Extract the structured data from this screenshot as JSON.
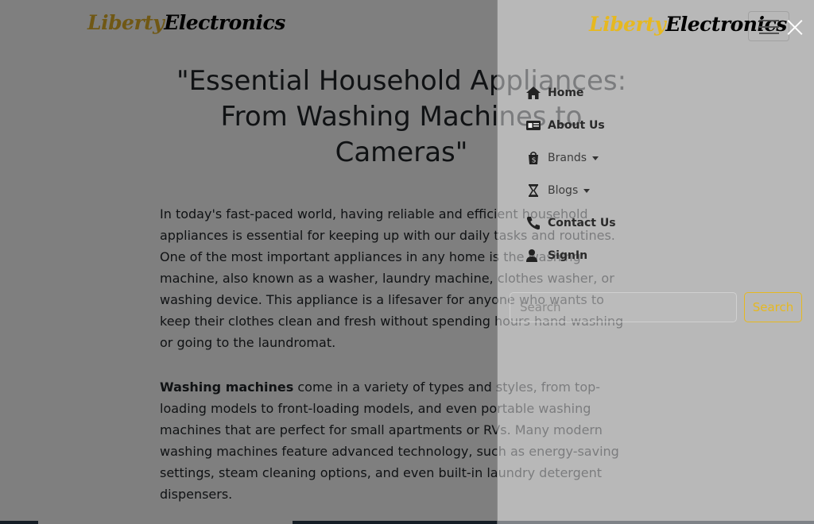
{
  "page": {
    "brand": {
      "part1": "Liberty",
      "part2": "Electronics"
    },
    "hero_title": "\"Essential Household Appliances: From Washing Machines to Cameras\"",
    "paragraph1": "In today's fast-paced world, having reliable and efficient household appliances is essential for keeping up with our daily tasks and routines. One of the most important appliances in any home is the washing machine, also known as a washer, laundry machine, clothes washer, or washing device. This appliance is a lifesaver for anyone who wants to keep their clothes clean and fresh without spending hours hand-washing or going to the laundromat.",
    "paragraph2_bold": "Washing machines",
    "paragraph2_rest": " come in a variety of types and styles, from top-loading models to front-loading models, and even portable washing machines that are perfect for small apartments or RVs. Many modern washing machines feature advanced technology, such as energy-saving settings, steam cleaning options, and even built-in laundry detergent dispensers."
  },
  "offcanvas": {
    "brand": {
      "part1": "Liberty",
      "part2": "Electronics"
    },
    "nav": [
      {
        "label": "Home",
        "icon": "home-icon",
        "dropdown": false
      },
      {
        "label": "About Us",
        "icon": "id-card-icon",
        "dropdown": false
      },
      {
        "label": "Brands",
        "icon": "shopping-bag-icon",
        "dropdown": true
      },
      {
        "label": "Blogs",
        "icon": "hourglass-icon",
        "dropdown": true
      },
      {
        "label": "Contact Us",
        "icon": "phone-icon",
        "dropdown": false
      },
      {
        "label": "SignIn",
        "icon": "user-icon",
        "dropdown": false
      }
    ],
    "search": {
      "placeholder": "Search",
      "button_label": "Search"
    }
  },
  "colors": {
    "brand_accent": "#e6b820",
    "backdrop": "rgba(0,0,0,0.5)"
  }
}
